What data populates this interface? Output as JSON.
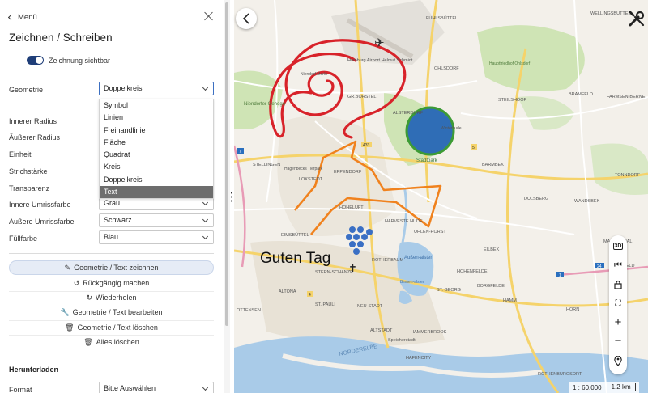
{
  "sidebar": {
    "back_label": "Menü",
    "title": "Zeichnen / Schreiben",
    "toggle_label": "Zeichnung sichtbar",
    "fields": {
      "geometrie": {
        "label": "Geometrie",
        "value": "Doppelkreis"
      },
      "innerer_radius": {
        "label": "Innerer Radius"
      },
      "aeusserer_radius": {
        "label": "Äußerer Radius"
      },
      "einheit": {
        "label": "Einheit"
      },
      "strichstaerke": {
        "label": "Strichstärke"
      },
      "transparenz": {
        "label": "Transparenz"
      },
      "innere_umrissfarbe": {
        "label": "Innere Umrissfarbe",
        "value": "Grau"
      },
      "aeussere_umrissfarbe": {
        "label": "Äußere Umrissfarbe",
        "value": "Schwarz"
      },
      "fuellfarbe": {
        "label": "Füllfarbe",
        "value": "Blau"
      }
    },
    "geometry_options": [
      "Symbol",
      "Linien",
      "Freihandlinie",
      "Fläche",
      "Quadrat",
      "Kreis",
      "Doppelkreis",
      "Text"
    ],
    "highlighted_option": "Text",
    "actions": {
      "draw": "Geometrie / Text zeichnen",
      "undo": "Rückgängig machen",
      "redo": "Wiederholen",
      "edit": "Geometrie / Text bearbeiten",
      "delete": "Geometrie / Text löschen",
      "delete_all": "Alles löschen"
    },
    "download": {
      "section_title": "Herunterladen",
      "format_label": "Format",
      "format_value": "Bitte Auswählen"
    }
  },
  "map": {
    "drawn_text": "Guten Tag",
    "scale_ratio": "1 : 60.000",
    "scale_distance": "1.2 km",
    "control_3d": "3D",
    "labels": {
      "airport": "Hamburg Airport Helmut Schmidt",
      "stadtpark": "Stadtpark",
      "eppendorf": "EPPENDORF",
      "hoheluft": "HOHELUFT",
      "harvestehude": "HARVESTE HUDE",
      "uhlenhorst": "UHLEN-HORST",
      "rotherbaum": "ROTHERBAUM",
      "eimsbuettel": "EIMSBÜTTEL",
      "altona": "ALTONA",
      "st_pauli": "ST. PAULI",
      "altstadt": "ALTSTADT",
      "hammerbrook": "HAMMERBROOK",
      "speicherstadt": "Speicherstadt",
      "hafencity": "HAFENCITY",
      "norderelbe": "NORDERELBE",
      "st_georg": "ST. GEORG",
      "hohenfelde": "HOHENFELDE",
      "barmbek": "BARMBEK",
      "winterhude": "Winterhude",
      "wandsbek": "WANDSBEK",
      "dulsberg": "DULSBERG",
      "eilbek": "EILBEK",
      "hamm": "HAMM",
      "horn": "HORN",
      "rothenburgsort": "ROTHENBURGSORT",
      "steilshoop": "STEILSHOOP",
      "bramfeld": "BRAMFELD",
      "farmsen": "FARMSEN-BERNE",
      "wellingsbuettel": "WELLINGSBÜTTEL",
      "fuhlsbuettel": "FUHLSBÜTTEL",
      "ohlsdorf": "OHLSDORF",
      "alsterdorf": "ALSTERDORF",
      "stellingen": "STELLINGEN",
      "lokstedt": "LOKSTEDT",
      "gross_borstel": "GR.BORSTEL",
      "niendorf": "Niendorfer Gehege",
      "aussenalster": "Außen-alster",
      "binnenalster": "Binnen-alster",
      "ottensen": "OTTENSEN",
      "hauptfriedhof": "Hauptfriedhof Ohlsdorf",
      "sternschanze": "STERN-SCHANZE",
      "neustadt": "NEU-STADT",
      "hagenbeck": "Hagenbecks Tierpark",
      "niendorf_markt": "Niendorf Markt",
      "borgfelde": "BORGFELDE",
      "marienthal": "MARIENTHAL",
      "jenfeld": "JENFELD",
      "tonndorf": "TONNDORF",
      "road_7": "7",
      "road_24": "24",
      "road_1": "1",
      "road_433": "433",
      "road_5": "5",
      "road_4": "4"
    }
  },
  "colors": {
    "accent": "#1f3e78",
    "freehand": "#d8232a",
    "polyline": "#f0821e",
    "circle_fill": "#2f6db6",
    "circle_stroke": "#3d9b35",
    "dots": "#3a6fc4",
    "water": "#a9cbe8",
    "green": "#cfe4b5"
  }
}
